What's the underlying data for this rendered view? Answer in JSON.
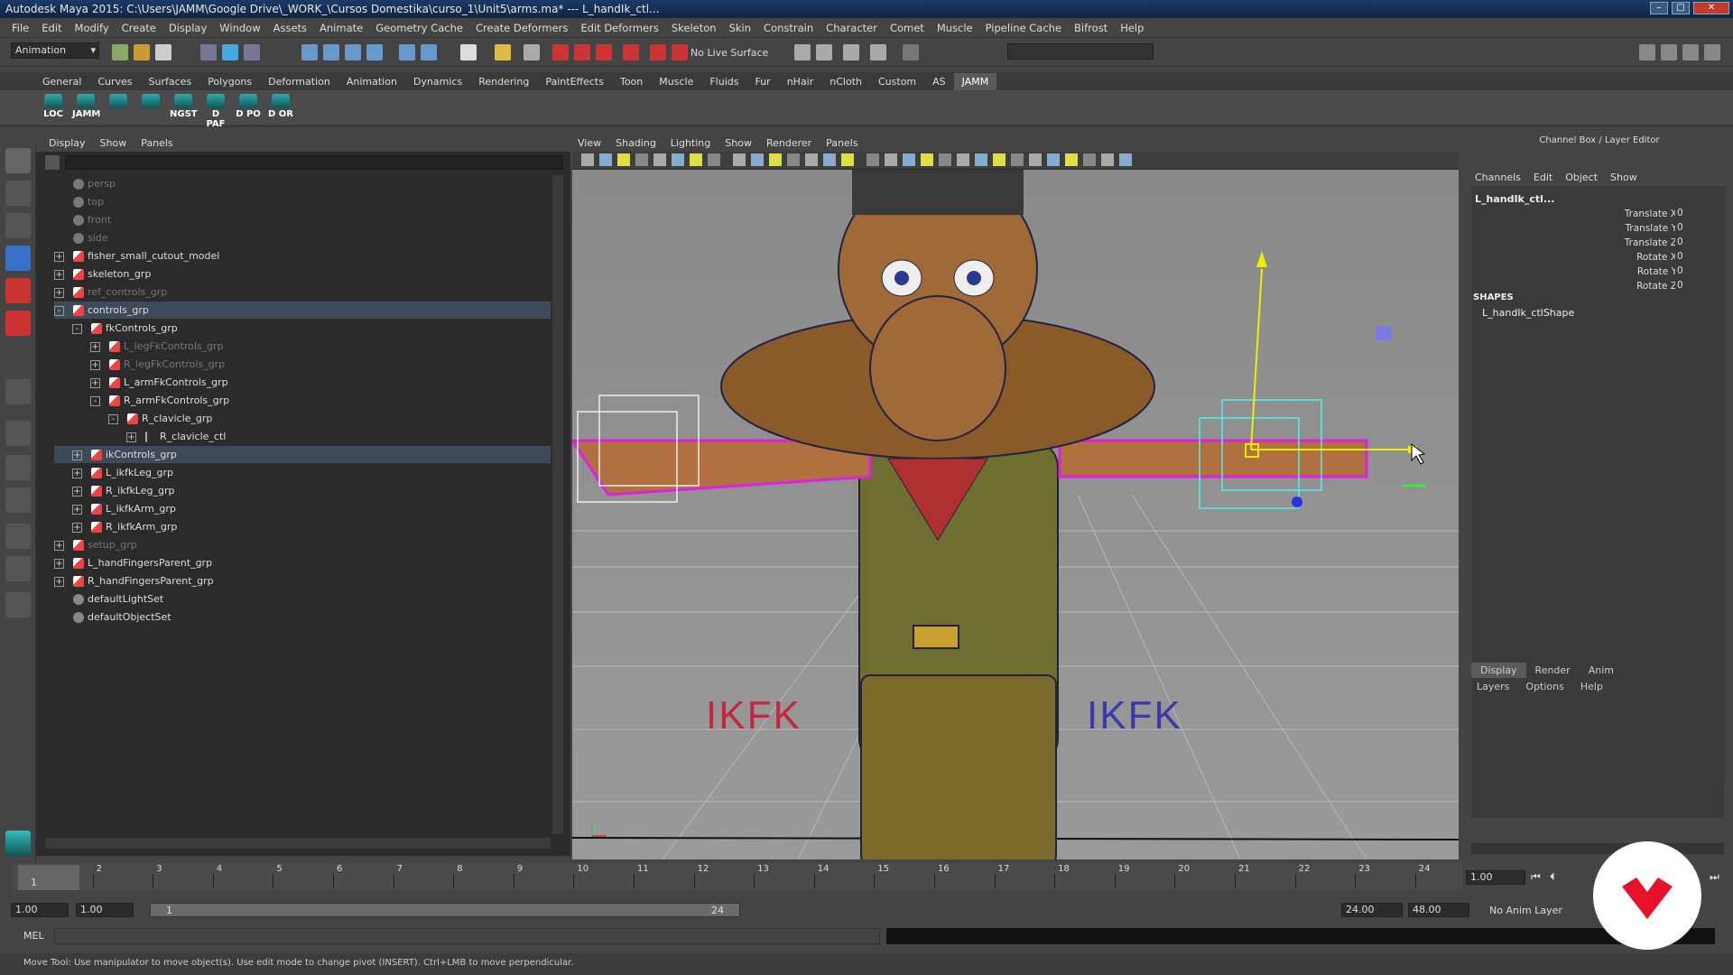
{
  "window": {
    "title": "Autodesk Maya 2015: C:\\Users\\JAMM\\Google Drive\\_WORK_\\Cursos Domestika\\curso_1\\Unit5\\arms.ma*   ---   L_handIk_ctl..."
  },
  "menubar": [
    "File",
    "Edit",
    "Modify",
    "Create",
    "Display",
    "Window",
    "Assets",
    "Animate",
    "Geometry Cache",
    "Create Deformers",
    "Edit Deformers",
    "Skeleton",
    "Skin",
    "Constrain",
    "Character",
    "Comet",
    "Muscle",
    "Pipeline Cache",
    "Bifrost",
    "Help"
  ],
  "statusline": {
    "mode": "Animation",
    "live_surface": "No Live Surface"
  },
  "shelf": {
    "tabs": [
      "General",
      "Curves",
      "Surfaces",
      "Polygons",
      "Deformation",
      "Animation",
      "Dynamics",
      "Rendering",
      "PaintEffects",
      "Toon",
      "Muscle",
      "Fluids",
      "Fur",
      "nHair",
      "nCloth",
      "Custom",
      "AS",
      "JAMM"
    ],
    "active_tab": "JAMM",
    "buttons": [
      "LOC",
      "JAMM",
      "",
      "",
      "NGST",
      "D PAF",
      "D PO",
      "D OR"
    ]
  },
  "outliner": {
    "menu": [
      "Display",
      "Show",
      "Panels"
    ],
    "items": [
      {
        "label": "persp",
        "depth": 0,
        "icon": "camera",
        "expand": "",
        "dim": true
      },
      {
        "label": "top",
        "depth": 0,
        "icon": "camera",
        "expand": "",
        "dim": true
      },
      {
        "label": "front",
        "depth": 0,
        "icon": "camera",
        "expand": "",
        "dim": true
      },
      {
        "label": "side",
        "depth": 0,
        "icon": "camera",
        "expand": "",
        "dim": true
      },
      {
        "label": "fisher_small_cutout_model",
        "depth": 0,
        "icon": "transform",
        "expand": "+"
      },
      {
        "label": "skeleton_grp",
        "depth": 0,
        "icon": "transform",
        "expand": "+"
      },
      {
        "label": "ref_controls_grp",
        "depth": 0,
        "icon": "transform",
        "expand": "+",
        "dim": true
      },
      {
        "label": "controls_grp",
        "depth": 0,
        "icon": "transform",
        "expand": "-",
        "selected": true
      },
      {
        "label": "fkControls_grp",
        "depth": 1,
        "icon": "transform",
        "expand": "-"
      },
      {
        "label": "L_legFkControls_grp",
        "depth": 2,
        "icon": "transform",
        "expand": "+",
        "dim": true
      },
      {
        "label": "R_legFkControls_grp",
        "depth": 2,
        "icon": "transform",
        "expand": "+",
        "dim": true
      },
      {
        "label": "L_armFkControls_grp",
        "depth": 2,
        "icon": "transform",
        "expand": "+"
      },
      {
        "label": "R_armFkControls_grp",
        "depth": 2,
        "icon": "transform",
        "expand": "-"
      },
      {
        "label": "R_clavicle_grp",
        "depth": 3,
        "icon": "transform",
        "expand": "-"
      },
      {
        "label": "R_clavicle_ctl",
        "depth": 4,
        "icon": "curve",
        "expand": "+"
      },
      {
        "label": "ikControls_grp",
        "depth": 1,
        "icon": "transform",
        "expand": "+",
        "selected": true
      },
      {
        "label": "L_ikfkLeg_grp",
        "depth": 1,
        "icon": "transform",
        "expand": "+"
      },
      {
        "label": "R_ikfkLeg_grp",
        "depth": 1,
        "icon": "transform",
        "expand": "+"
      },
      {
        "label": "L_ikfkArm_grp",
        "depth": 1,
        "icon": "transform",
        "expand": "+"
      },
      {
        "label": "R_ikfkArm_grp",
        "depth": 1,
        "icon": "transform",
        "expand": "+"
      },
      {
        "label": "setup_grp",
        "depth": 0,
        "icon": "transform",
        "expand": "+",
        "dim": true
      },
      {
        "label": "L_handFingersParent_grp",
        "depth": 0,
        "icon": "transform",
        "expand": "+"
      },
      {
        "label": "R_handFingersParent_grp",
        "depth": 0,
        "icon": "transform",
        "expand": "+"
      },
      {
        "label": "defaultLightSet",
        "depth": 0,
        "icon": "set",
        "expand": ""
      },
      {
        "label": "defaultObjectSet",
        "depth": 0,
        "icon": "set",
        "expand": ""
      }
    ]
  },
  "viewport": {
    "menu": [
      "View",
      "Shading",
      "Lighting",
      "Show",
      "Renderer",
      "Panels"
    ],
    "label_left": "IKFK",
    "label_right": "IKFK"
  },
  "channelbox": {
    "header": "Channel Box / Layer Editor",
    "menu": [
      "Channels",
      "Edit",
      "Object",
      "Show"
    ],
    "object": "L_handIk_ctl...",
    "attributes": [
      {
        "name": "Translate X",
        "value": "0"
      },
      {
        "name": "Translate Y",
        "value": "0"
      },
      {
        "name": "Translate Z",
        "value": "0"
      },
      {
        "name": "Rotate X",
        "value": "0"
      },
      {
        "name": "Rotate Y",
        "value": "0"
      },
      {
        "name": "Rotate Z",
        "value": "0"
      }
    ],
    "shapes_label": "SHAPES",
    "shape": "L_handIk_ctlShape",
    "layer_tabs": [
      "Display",
      "Render",
      "Anim"
    ],
    "layer_menu": [
      "Layers",
      "Options",
      "Help"
    ]
  },
  "timeline": {
    "ticks": [
      "1",
      "2",
      "3",
      "4",
      "5",
      "6",
      "7",
      "8",
      "9",
      "10",
      "11",
      "12",
      "13",
      "14",
      "15",
      "16",
      "17",
      "18",
      "19",
      "20",
      "21",
      "22",
      "23",
      "24"
    ],
    "current_frame_label": "1",
    "current_time": "1.00"
  },
  "range": {
    "start": "1.00",
    "playback_start": "1.00",
    "slider_start": "1",
    "slider_end": "24",
    "playback_end": "24.00",
    "end": "48.00",
    "anim_layer": "No Anim Layer"
  },
  "commandline": {
    "label": "MEL"
  },
  "helpline": {
    "text": "Move Tool: Use manipulator to move object(s). Use edit mode to change pivot (INSERT). Ctrl+LMB to move perpendicular."
  },
  "colors": {
    "accent": "#1b3b66",
    "brand_logo": "#e8102a",
    "ik_left": "#d0203a",
    "ik_right": "#3a3aa0",
    "selection_wire": "#e020e0"
  }
}
